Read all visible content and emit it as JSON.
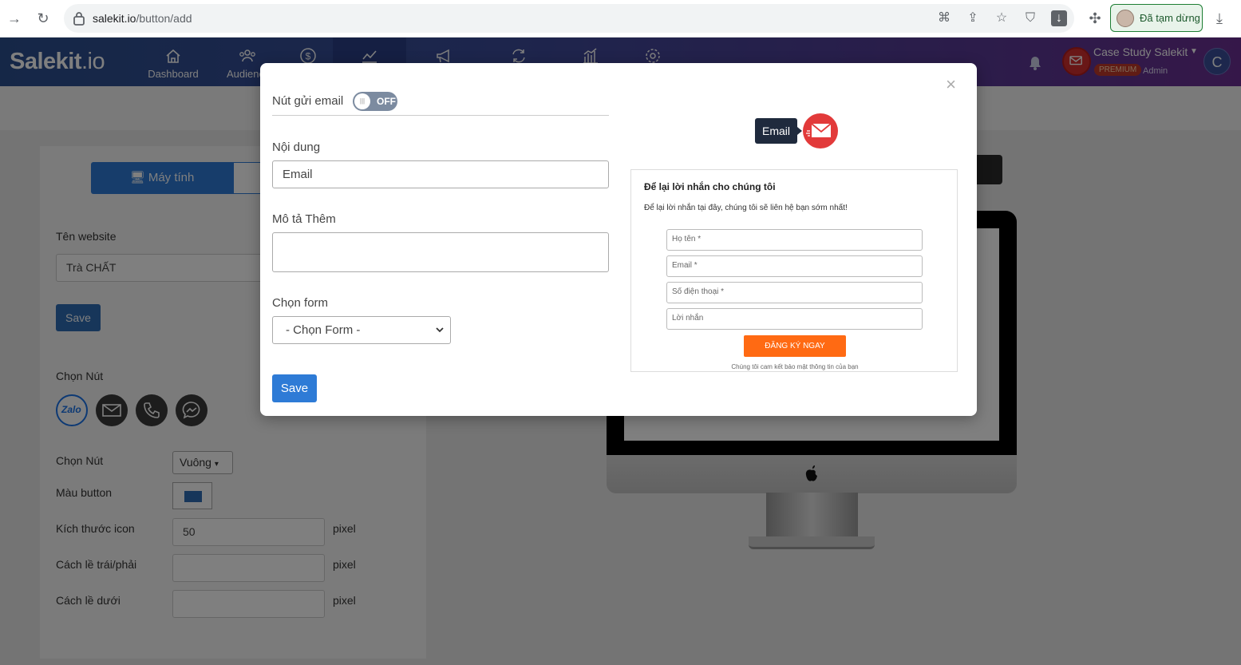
{
  "browser": {
    "url_domain": "salekit.io",
    "url_path": "/button/add",
    "profile_label": "Đã tạm dừng"
  },
  "header": {
    "logo_main": "Salekit",
    "logo_suffix": ".io",
    "nav": [
      {
        "label": "Dashboard",
        "icon": "home-icon"
      },
      {
        "label": "Audience",
        "icon": "users-icon"
      },
      {
        "label": "",
        "icon": "dollar-icon"
      },
      {
        "label": "",
        "icon": "chart-icon"
      },
      {
        "label": "",
        "icon": "megaphone-icon"
      },
      {
        "label": "",
        "icon": "refresh-icon"
      },
      {
        "label": "",
        "icon": "bar-chart-icon"
      },
      {
        "label": "",
        "icon": "gear-icon"
      }
    ],
    "account_name": "Case Study Salekit",
    "badge": "PREMIUM",
    "role": "Admin",
    "avatar_letter": "C"
  },
  "left_panel": {
    "tab_desktop": "Máy tính",
    "website_label": "Tên website",
    "website_value": "Trà CHẤT",
    "save": "Save",
    "choose_button_label": "Chọn Nút",
    "choose_shape_label": "Chọn Nút",
    "shape_value": "Vuông",
    "color_label": "Màu button",
    "icon_size_label": "Kích thước icon",
    "icon_size_value": "50",
    "margin_lr_label": "Cách lề trái/phải",
    "margin_bottom_label": "Cách lề dưới",
    "pixel": "pixel",
    "button_color": "#2f6db5"
  },
  "modal": {
    "email_toggle_label": "Nút gửi email",
    "toggle_state": "OFF",
    "content_label": "Nội dung",
    "content_value": "Email",
    "desc_label": "Mô tả Thêm",
    "desc_value": "",
    "form_label": "Chọn form",
    "form_value": "- Chọn Form -",
    "save": "Save",
    "close": "×"
  },
  "preview": {
    "tooltip": "Email",
    "form_title": "Để lại lời nhắn cho chúng tôi",
    "form_sub": "Để lại lời nhắn tại đây, chúng tôi sẽ liên hệ bạn sớm nhất!",
    "fields": [
      "Họ tên *",
      "Email *",
      "Số điện thoại *",
      "Lời nhắn"
    ],
    "submit": "ĐĂNG KÝ NGAY",
    "footer": "Chúng tôi cam kết bảo mật thông tin của bạn"
  }
}
